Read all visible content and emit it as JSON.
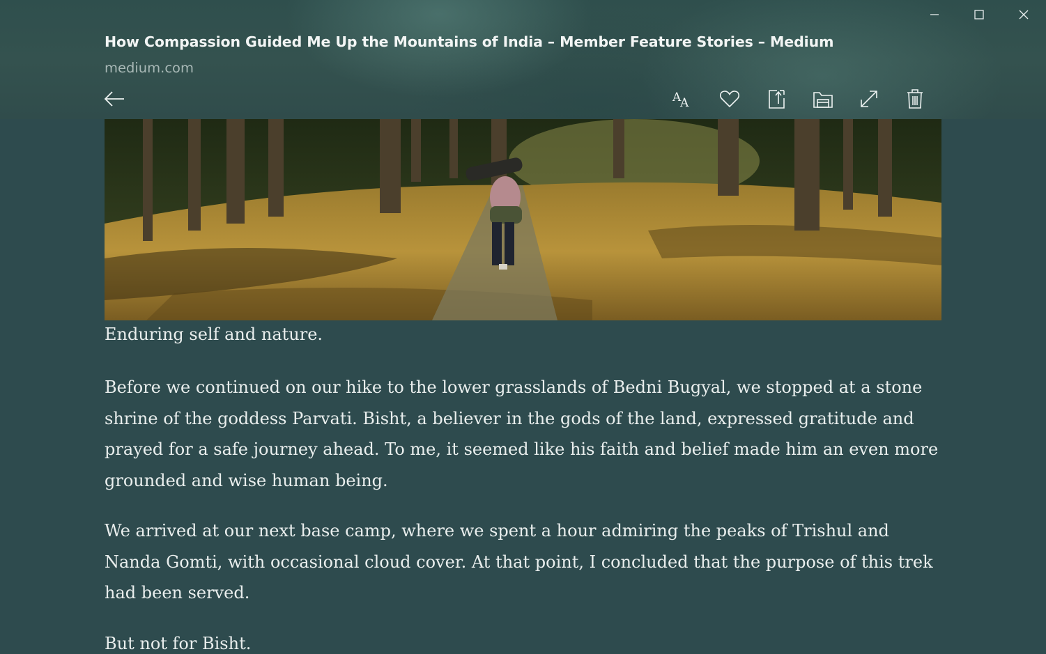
{
  "window": {
    "controls": [
      "minimize",
      "maximize",
      "close"
    ]
  },
  "header": {
    "title": "How Compassion Guided Me Up the Mountains of India – Member Feature Stories – Medium",
    "domain": "medium.com"
  },
  "toolbar": {
    "text_size_glyph": "AA",
    "icons": [
      "text-size-icon",
      "heart-icon",
      "share-icon",
      "archive-icon",
      "expand-icon",
      "trash-icon"
    ]
  },
  "article": {
    "image_subject": "hiker with backpack walking a stone path through a forest of leaf-covered ground",
    "caption": "Enduring self and nature.",
    "paragraphs": [
      "Before we continued on our hike to the lower grasslands of Bedni Bugyal, we stopped at a stone shrine of the goddess Parvati. Bisht, a believer in the gods of the land, expressed gratitude and prayed for a safe journey ahead. To me, it seemed like his faith and belief made him an even more grounded and wise human being.",
      "We arrived at our next base camp, where we spent a hour admiring the peaks of Trishul and Nanda Gomti, with occasional cloud cover. At that point, I concluded that the purpose of this trek had been served.",
      "But not for Bisht."
    ]
  },
  "colors": {
    "background": "#2e4b4e",
    "text": "#e9eeed",
    "header_text": "#f2f5f4",
    "domain_text": "#a8b8b6"
  }
}
